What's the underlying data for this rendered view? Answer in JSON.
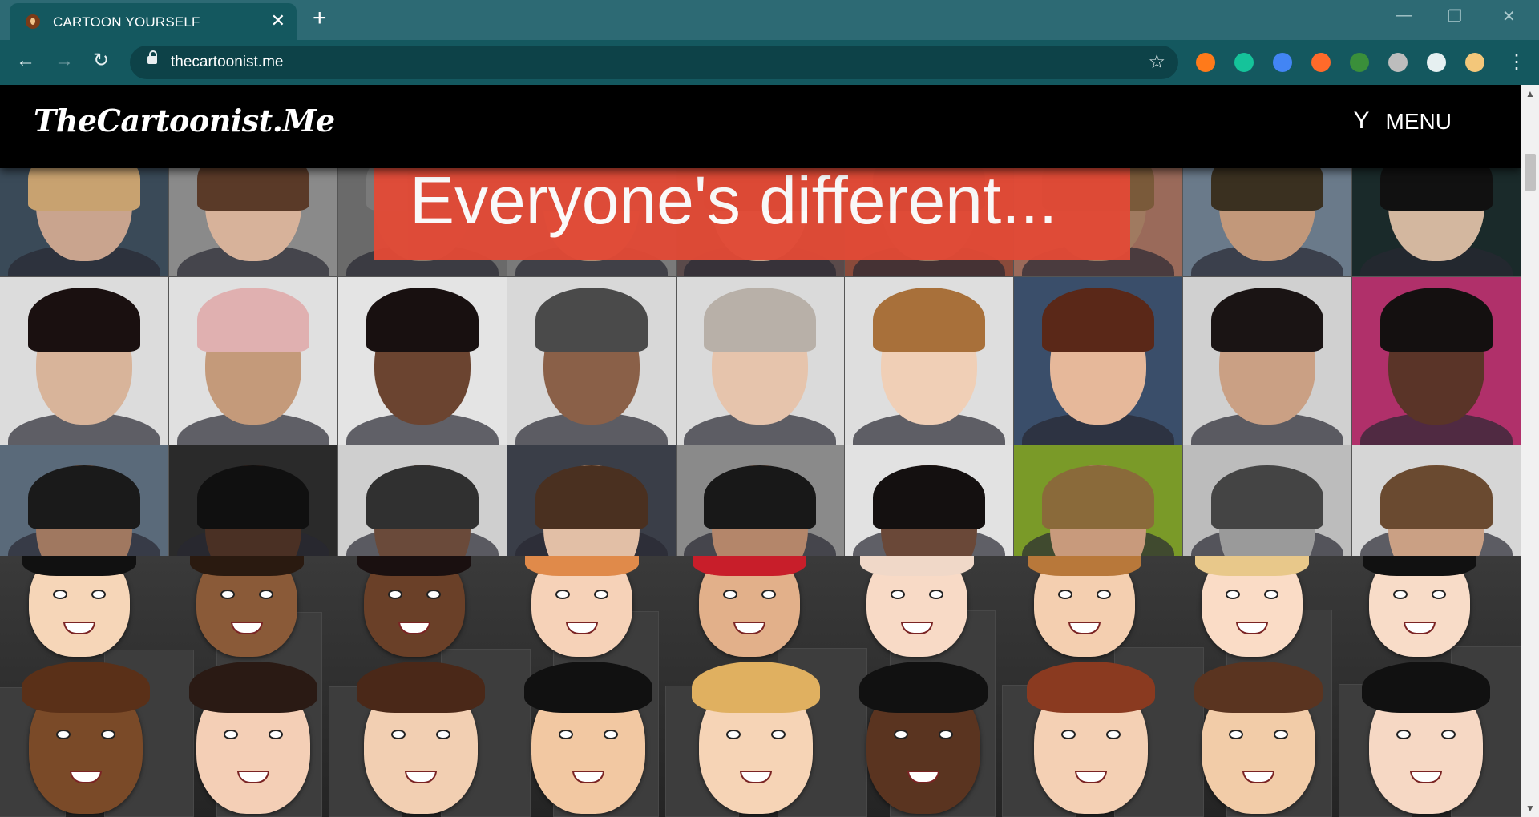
{
  "browser": {
    "tab_title": "CARTOON YOURSELF",
    "tab_close": "✕",
    "new_tab": "+",
    "url": "thecartoonist.me",
    "back": "←",
    "forward": "→",
    "reload": "↻",
    "bookmark": "☆",
    "window_minimize": "—",
    "window_restore": "❐",
    "window_close": "✕",
    "extensions": [
      {
        "icon": "infinity-extension-icon",
        "color": "#ff7a1a"
      },
      {
        "icon": "grammarly-icon",
        "color": "#15c39a"
      },
      {
        "icon": "google-translate-icon",
        "color": "#4285f4"
      },
      {
        "icon": "megaphone-extension-icon",
        "color": "#ff6a2a"
      },
      {
        "icon": "colorful-extension-icon",
        "color": "#3a8f3a"
      },
      {
        "icon": "circle-extension-icon",
        "color": "#bdbdbd"
      },
      {
        "icon": "puzzle-extensions-icon",
        "color": "#e6f0f1"
      },
      {
        "icon": "profile-avatar-icon",
        "color": "#f3c77a"
      }
    ],
    "menu_dots": "⋮"
  },
  "site": {
    "logo": "TheCartoonist.Me",
    "menu_label": "MENU",
    "menu_icon": "Y",
    "banner_text": "Everyone's different...",
    "photo_skin_tones": [
      [
        "#c9a48e",
        "#d7b29a",
        "#8a7a6a",
        "#b08a70",
        "#c8a38a",
        "#9a7a62",
        "#a07a60",
        "#c2987a",
        "#d3b79f"
      ],
      [
        "#d8b49a",
        "#c49a7a",
        "#6b4430",
        "#8a6048",
        "#e6c4ac",
        "#f0cfb6",
        "#e6b89a",
        "#caa084",
        "#5a3428"
      ],
      [
        "#a07860",
        "#4a3024",
        "#6a4a3a",
        "#e2bfa6",
        "#b4866a",
        "#6a4838",
        "#c89a7c",
        "#9a9a9a",
        "#caa084"
      ]
    ],
    "photo_hair_colors": [
      [
        "#c8a270",
        "#5a3a28",
        "#7a7a7a",
        "#6a6a6a",
        "#4a3a2a",
        "#2a2a2a",
        "#7a5a3a",
        "#3a3020",
        "#111111"
      ],
      [
        "#1a1010",
        "#e0b0b0",
        "#181010",
        "#4a4a4a",
        "#b8b0a8",
        "#a8703a",
        "#5a2818",
        "#1a1414",
        "#141010"
      ],
      [
        "#1a1a1a",
        "#101010",
        "#303030",
        "#4a3020",
        "#181818",
        "#141010",
        "#8a6a3a",
        "#444444",
        "#6a4a30"
      ]
    ],
    "photo_bg_colors": [
      [
        "#3a4a58",
        "#8a8a8a",
        "#6a6a6a",
        "#7a7a7a",
        "#5a4a4a",
        "#8a4a3a",
        "#9a6a5a",
        "#6a7a8a",
        "#1a2a2a"
      ],
      [
        "#dcdcdc",
        "#e0e0e0",
        "#e4e4e4",
        "#d8d8d8",
        "#dadada",
        "#dedede",
        "#3a4e6a",
        "#d0d0d0",
        "#b0306a"
      ],
      [
        "#5a6a7a",
        "#2a2a2a",
        "#cfcfcf",
        "#3a3e48",
        "#8a8a8a",
        "#e2e2e2",
        "#7a9a28",
        "#bcbcbc",
        "#d6d6d6"
      ]
    ],
    "cartoons": [
      {
        "skin": "#f6d6b8",
        "hair": "#111111"
      },
      {
        "skin": "#8a5a38",
        "hair": "#2a1a10"
      },
      {
        "skin": "#6a4028",
        "hair": "#1a1010"
      },
      {
        "skin": "#f6d2b8",
        "hair": "#e08a4a"
      },
      {
        "skin": "#e2b08a",
        "hair": "#c81e2a"
      },
      {
        "skin": "#f8dac6",
        "hair": "#f0d8c8"
      },
      {
        "skin": "#f4cfb0",
        "hair": "#b8783a"
      },
      {
        "skin": "#fadcc6",
        "hair": "#e8c88a"
      },
      {
        "skin": "#f8dcc8",
        "hair": "#111111"
      },
      {
        "skin": "#7a4a28",
        "hair": "#5a3018"
      },
      {
        "skin": "#f4cfb6",
        "hair": "#2a1a14"
      },
      {
        "skin": "#f2cfb2",
        "hair": "#4a2818"
      },
      {
        "skin": "#f2c8a2",
        "hair": "#111111"
      },
      {
        "skin": "#f6d4b6",
        "hair": "#e0b060"
      },
      {
        "skin": "#5a3420",
        "hair": "#111111"
      },
      {
        "skin": "#f4d0b4",
        "hair": "#8a3a20"
      },
      {
        "skin": "#f2cca8",
        "hair": "#5a3420"
      },
      {
        "skin": "#f6d8c4",
        "hair": "#111111"
      }
    ]
  }
}
